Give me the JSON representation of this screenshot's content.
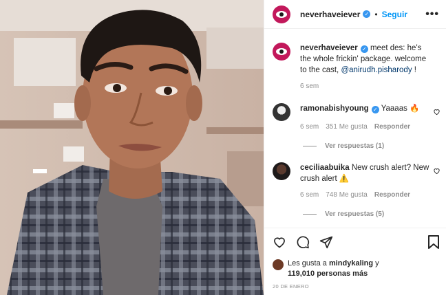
{
  "post": {
    "username": "neverhaveiever",
    "follow_label": "Seguir",
    "more_label": "•••"
  },
  "caption": {
    "username": "neverhaveiever",
    "text": "meet des: he's the whole frickin' package. welcome to the cast,",
    "mention": "@anirudh.pisharody",
    "end": " !",
    "time": "6 sem"
  },
  "comments": [
    {
      "username": "ramonabishyoung",
      "text": "Yaaaas 🔥",
      "time": "6 sem",
      "likes": "351 Me gusta",
      "reply_label": "Responder",
      "view_replies": "Ver respuestas (1)"
    },
    {
      "username": "ceciliaabuika",
      "text": "New crush alert? New crush alert ⚠️",
      "time": "6 sem",
      "likes": "748 Me gusta",
      "reply_label": "Responder",
      "view_replies": "Ver respuestas (5)"
    }
  ],
  "likes": {
    "line1_prefix": "Les gusta a ",
    "user": "mindykaling",
    "line1_suffix": " y",
    "line2": "119,010 personas más"
  },
  "date": "20 DE ENERO",
  "icons": {
    "like": "heart-icon",
    "comment": "comment-icon",
    "share": "share-icon",
    "save": "bookmark-icon"
  },
  "colors": {
    "link": "#0095f6",
    "brand_avatar": "#c2185b",
    "verified": "#3897f0",
    "meta_text": "#8e8e8e"
  }
}
